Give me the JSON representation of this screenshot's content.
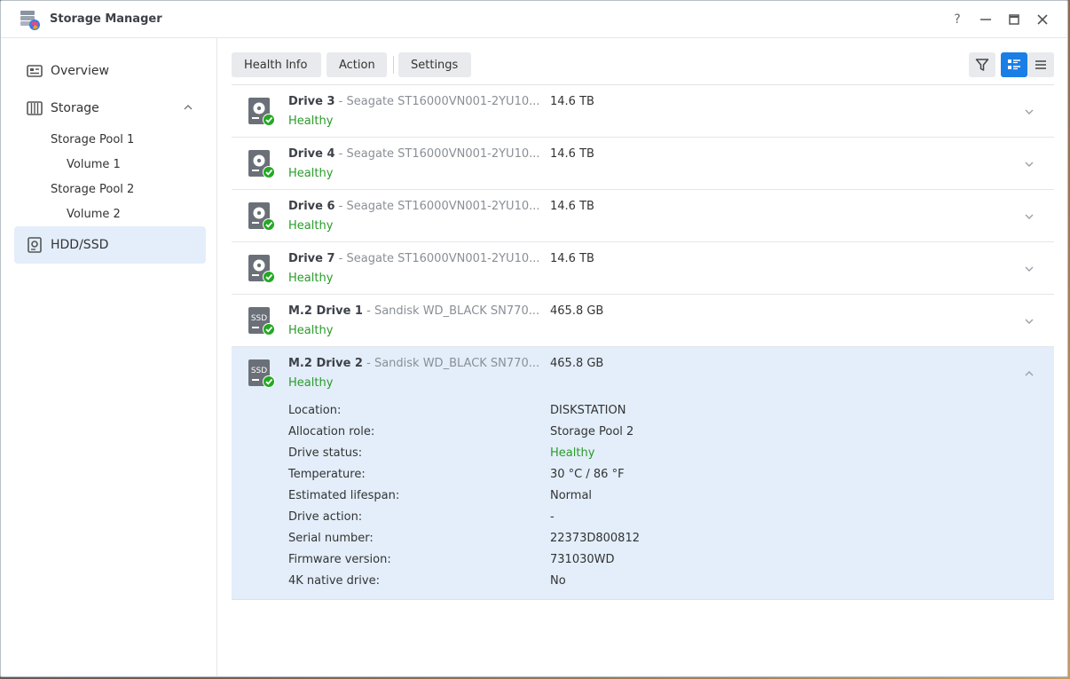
{
  "app": {
    "title": "Storage Manager"
  },
  "window_controls": {
    "help": "?",
    "minimize": "—",
    "maximize": "□",
    "close": "✕"
  },
  "sidebar": {
    "overview": "Overview",
    "storage": "Storage",
    "pools": [
      {
        "label": "Storage Pool 1",
        "volume": "Volume 1"
      },
      {
        "label": "Storage Pool 2",
        "volume": "Volume 2"
      }
    ],
    "hdd": "HDD/SSD"
  },
  "toolbar": {
    "health_info": "Health Info",
    "action": "Action",
    "settings": "Settings"
  },
  "drives": [
    {
      "name": "Drive 3",
      "model": "Seagate ST16000VN001-2YU10...",
      "size": "14.6 TB",
      "status": "Healthy",
      "type": "hdd"
    },
    {
      "name": "Drive 4",
      "model": "Seagate ST16000VN001-2YU10...",
      "size": "14.6 TB",
      "status": "Healthy",
      "type": "hdd"
    },
    {
      "name": "Drive 6",
      "model": "Seagate ST16000VN001-2YU10...",
      "size": "14.6 TB",
      "status": "Healthy",
      "type": "hdd"
    },
    {
      "name": "Drive 7",
      "model": "Seagate ST16000VN001-2YU10...",
      "size": "14.6 TB",
      "status": "Healthy",
      "type": "hdd"
    },
    {
      "name": "M.2 Drive 1",
      "model": "Sandisk WD_BLACK SN770...",
      "size": "465.8 GB",
      "status": "Healthy",
      "type": "ssd"
    },
    {
      "name": "M.2 Drive 2",
      "model": "Sandisk WD_BLACK SN770...",
      "size": "465.8 GB",
      "status": "Healthy",
      "type": "ssd"
    }
  ],
  "dash": "-",
  "ssd_badge": "SSD",
  "details": [
    {
      "label": "Location:",
      "value": "DISKSTATION"
    },
    {
      "label": "Allocation role:",
      "value": "Storage Pool 2"
    },
    {
      "label": "Drive status:",
      "value": "Healthy"
    },
    {
      "label": "Temperature:",
      "value": "30 °C / 86 °F"
    },
    {
      "label": "Estimated lifespan:",
      "value": "Normal"
    },
    {
      "label": "Drive action:",
      "value": "-"
    },
    {
      "label": "Serial number:",
      "value": "22373D800812"
    },
    {
      "label": "Firmware version:",
      "value": "731030WD"
    },
    {
      "label": "4K native drive:",
      "value": "No"
    }
  ],
  "colors": {
    "accent": "#1a7ee6",
    "healthy": "#2a9b2a",
    "selected_bg": "#e3eefa"
  }
}
